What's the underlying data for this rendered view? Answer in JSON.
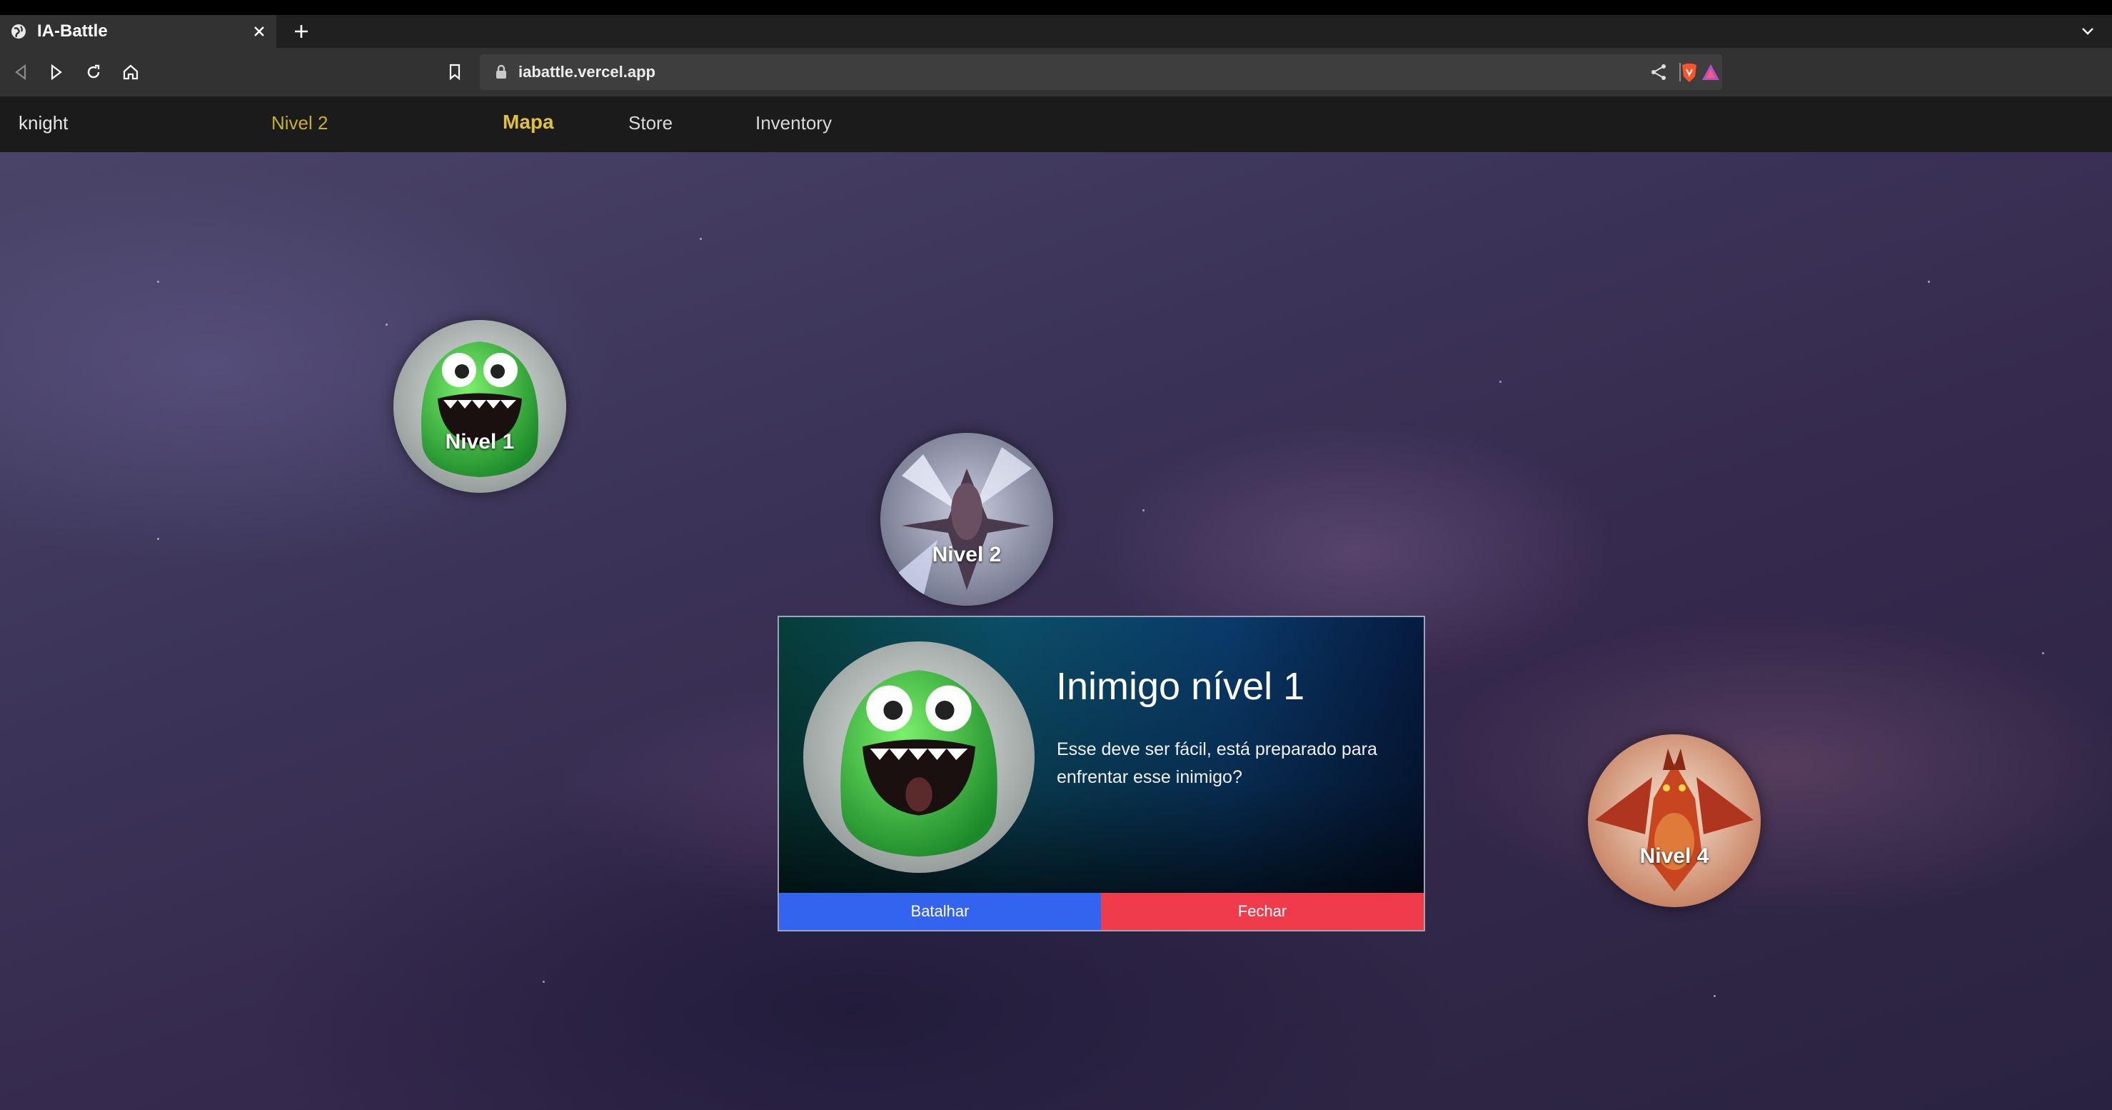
{
  "browser": {
    "tab_title": "IA-Battle",
    "url": "iabattle.vercel.app"
  },
  "nav": {
    "username": "knight",
    "level": "Nivel 2",
    "links": [
      "Mapa",
      "Store",
      "Inventory"
    ]
  },
  "map": {
    "levels": [
      "Nivel 1",
      "Nivel 2",
      "Nivel 4"
    ]
  },
  "dialog": {
    "title": "Inimigo nível 1",
    "text": "Esse deve ser fácil, está preparado para enfrentar esse inimigo?",
    "fight_label": "Batalhar",
    "close_label": "Fechar"
  },
  "colors": {
    "active_nav": "#e0c13a",
    "fight_button": "#3264f0",
    "close_button": "#ef3b4a"
  }
}
